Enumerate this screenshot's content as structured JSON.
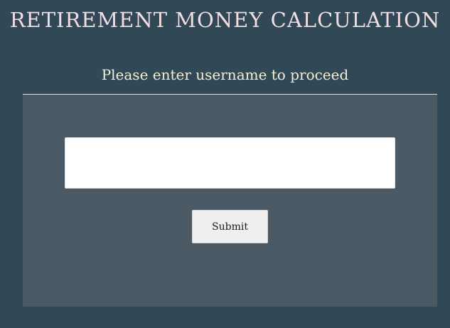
{
  "page": {
    "title": "RETIREMENT MONEY CALCULATION",
    "prompt": "Please enter username to proceed"
  },
  "form": {
    "username_value": "",
    "username_placeholder": "",
    "submit_label": "Submit"
  },
  "colors": {
    "background": "#314856",
    "panel": "#4a5963",
    "title": "#f3dde3",
    "prompt": "#f4f0d8",
    "input_background": "#ffffff",
    "button_background": "#efefef"
  }
}
